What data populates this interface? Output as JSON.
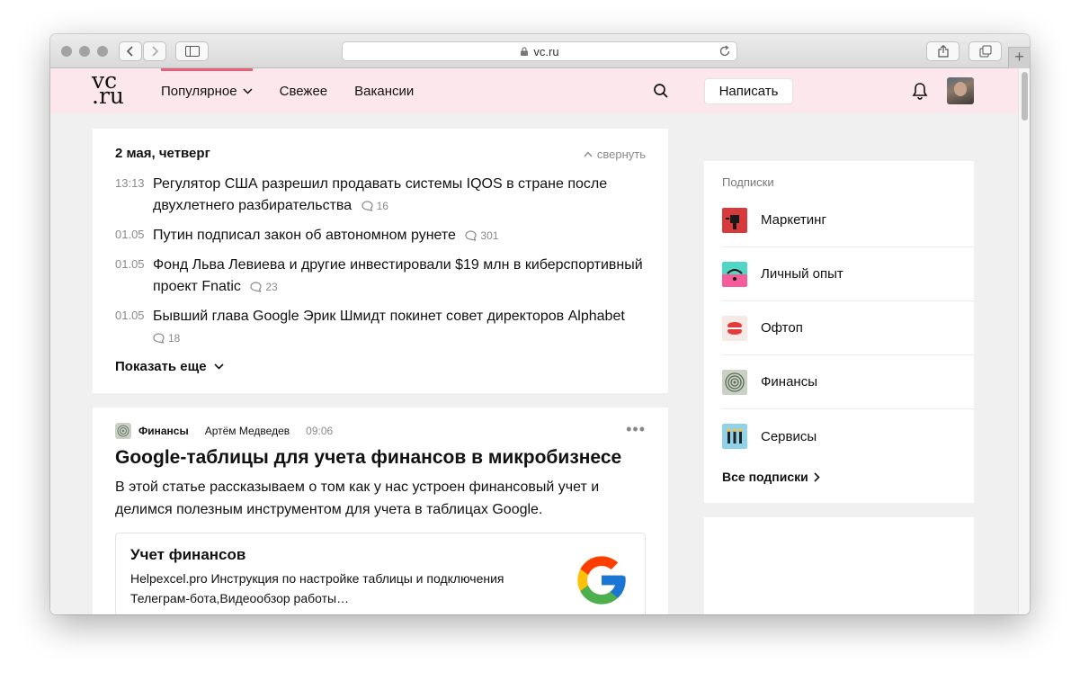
{
  "browser": {
    "url": "vc.ru",
    "new_tab_label": "+"
  },
  "site": {
    "logo_top": "vc",
    "logo_bottom": ".ru",
    "accent_color": "#e5637a",
    "header_bg": "#fce8ec",
    "nav": [
      {
        "label": "Популярное",
        "active": true,
        "dropdown": true
      },
      {
        "label": "Свежее"
      },
      {
        "label": "Вакансии"
      }
    ],
    "write_button": "Написать",
    "icons": [
      "search-icon",
      "bell-icon",
      "avatar"
    ]
  },
  "feed": {
    "date": "2 мая, четверг",
    "collapse_label": "свернуть",
    "items": [
      {
        "time": "13:13",
        "text": "Регулятор США разрешил продавать системы IQOS в стране после двухлетнего разбирательства",
        "comments": "16"
      },
      {
        "time": "01.05",
        "text": "Путин подписал закон об автономном рунете",
        "comments": "301"
      },
      {
        "time": "01.05",
        "text": "Фонд Льва Левиева и другие инвестировали $19 млн в киберспортивный проект Fnatic",
        "comments": "23"
      },
      {
        "time": "01.05",
        "text": "Бывший глава Google Эрик Шмидт покинет совет директоров Alphabet",
        "comments": "18"
      }
    ],
    "show_more": "Показать еще"
  },
  "post": {
    "category": "Финансы",
    "author": "Артём Медведев",
    "time": "09:06",
    "menu": "•••",
    "title": "Google-таблицы для учета финансов в микробизнесе",
    "lead": "В этой статье рассказываем о том как у нас устроен финансовый учет и делимся полезным инструментом для учета в таблицах Google.",
    "link": {
      "title": "Учет финансов",
      "description": "Helpexcel.pro Инструкция по настройке таблицы и подключения Телеграм-бота,Видеообзор работы…",
      "icon": "google-logo"
    }
  },
  "subscriptions": {
    "title": "Подписки",
    "items": [
      {
        "label": "Маркетинг",
        "icon": "marketing-icon"
      },
      {
        "label": "Личный опыт",
        "icon": "personal-experience-icon"
      },
      {
        "label": "Офтоп",
        "icon": "offtop-icon"
      },
      {
        "label": "Финансы",
        "icon": "finance-icon"
      },
      {
        "label": "Сервисы",
        "icon": "services-icon"
      }
    ],
    "all_label": "Все подписки"
  }
}
